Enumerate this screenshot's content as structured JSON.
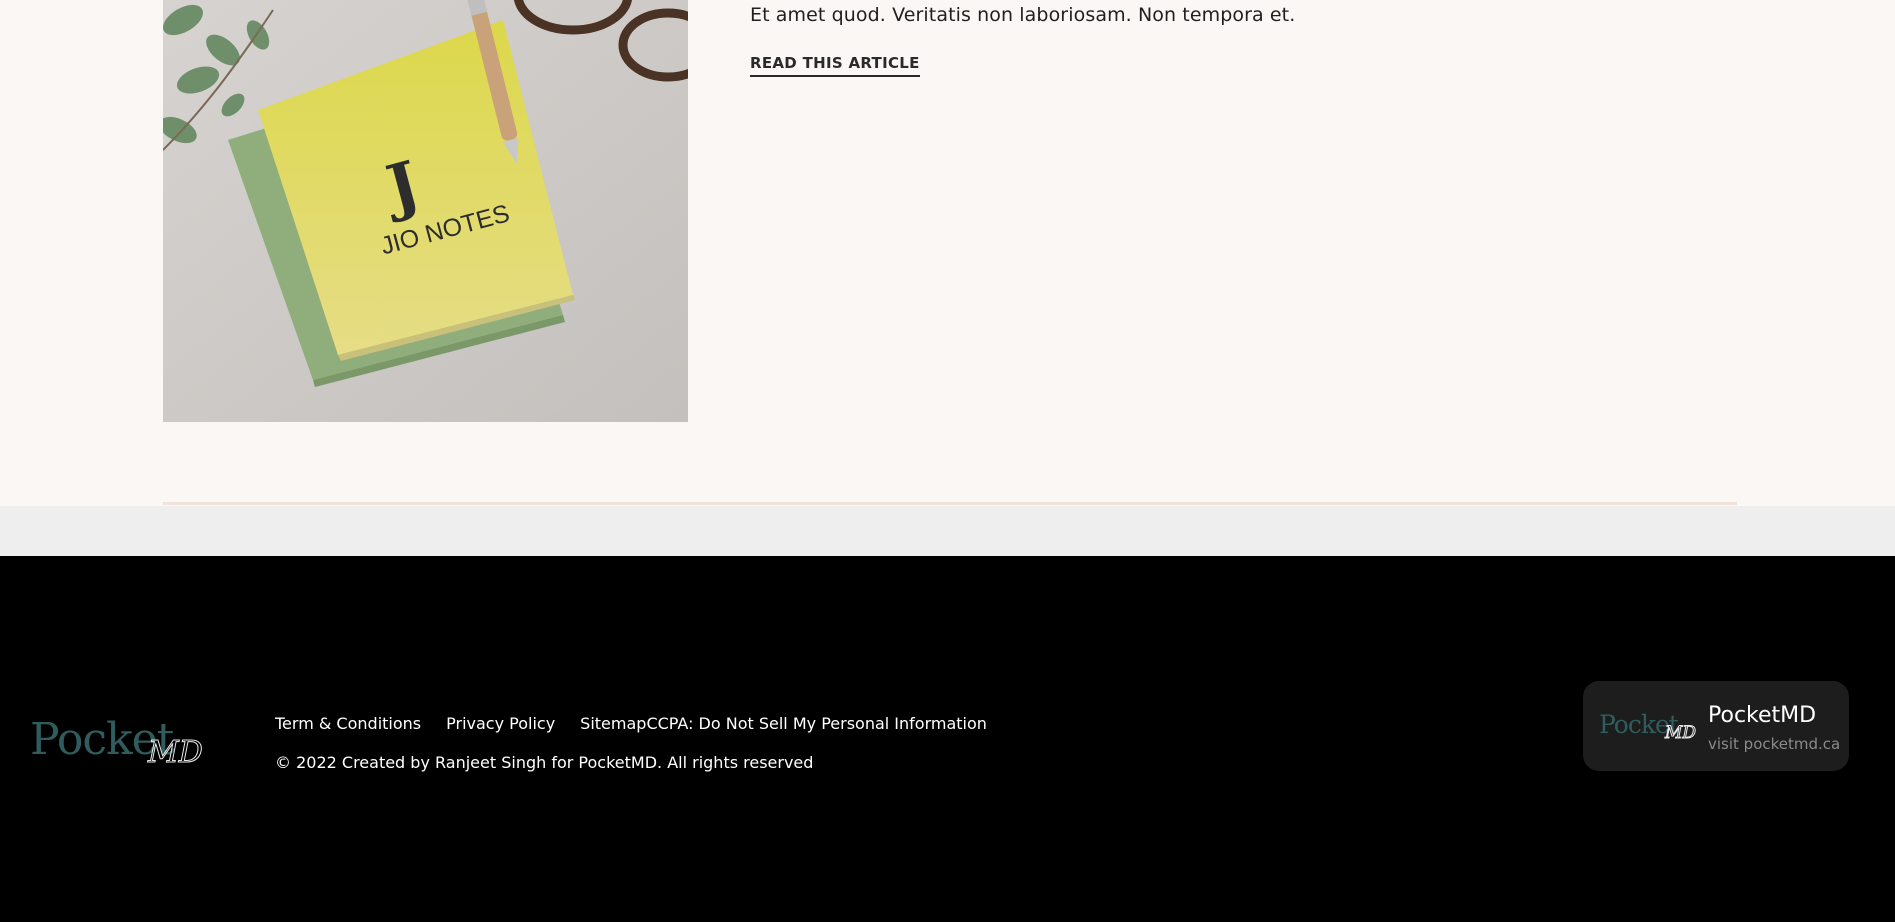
{
  "article": {
    "excerpt": "Et amet quod. Veritatis non laboriosam. Non tempora et.",
    "read_more": "READ THIS ARTICLE",
    "image_notebook_text": "JIO NOTES",
    "image_monogram": "J"
  },
  "footer": {
    "logo_word": "Pocket",
    "logo_script": "MD",
    "links": [
      "Term & Conditions",
      "Privacy Policy",
      "SitemapCCPA: Do Not Sell My Personal Information"
    ],
    "copyright": "© 2022 Created by Ranjeet Singh for PocketMD. All rights reserved"
  },
  "badge": {
    "title": "PocketMD",
    "subtitle": "visit pocketmd.ca"
  },
  "colors": {
    "page_bg": "#faf7f4",
    "footer_bg": "#000000",
    "logo_teal": "#2f5d5d",
    "badge_bg": "#1d1d1d"
  }
}
